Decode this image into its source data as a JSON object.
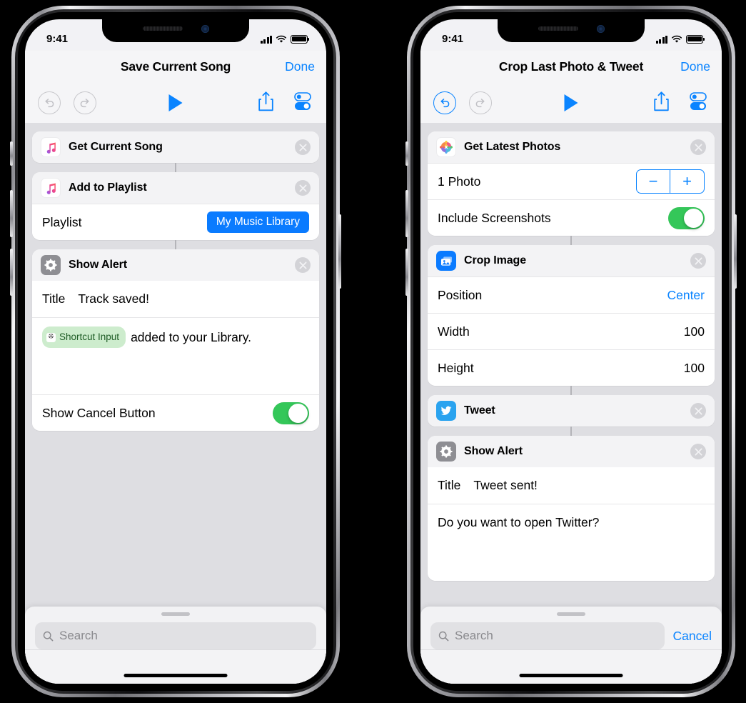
{
  "phones": [
    {
      "status": {
        "time": "9:41",
        "signal_icon": "cellular-bars-icon",
        "wifi_icon": "wifi-icon",
        "battery_icon": "battery-full-icon"
      },
      "nav": {
        "title": "Save Current Song",
        "done_label": "Done"
      },
      "toolbar": {
        "undo_icon": "undo-arrow-icon",
        "undo_enabled": "false",
        "redo_icon": "redo-arrow-icon",
        "redo_enabled": "false",
        "play_icon": "play-triangle-icon",
        "share_icon": "share-upload-icon",
        "settings_icon": "toggles-settings-icon",
        "accent": "#0a84ff"
      },
      "cards": [
        {
          "icon": "apple-music-icon",
          "title": "Get Current Song",
          "delete_icon": "close-circle-icon",
          "rows": []
        },
        {
          "icon": "apple-music-icon",
          "title": "Add to Playlist",
          "delete_icon": "close-circle-icon",
          "rows": [
            {
              "kind": "pill",
              "label": "Playlist",
              "value": "My Music Library"
            }
          ]
        },
        {
          "icon": "gear-settings-icon",
          "title": "Show Alert",
          "delete_icon": "close-circle-icon",
          "rows": [
            {
              "kind": "title",
              "label": "Title",
              "value": "Track saved!"
            },
            {
              "kind": "message",
              "token": "Shortcut Input",
              "token_icon": "variable-token-icon",
              "text": "added to your Library."
            },
            {
              "kind": "switch",
              "label": "Show Cancel Button",
              "value": "on"
            }
          ]
        }
      ],
      "sheet": {
        "search_placeholder": "Search",
        "search_icon": "search-icon",
        "cancel_label": "",
        "show_cancel": "false"
      }
    },
    {
      "status": {
        "time": "9:41",
        "signal_icon": "cellular-bars-icon",
        "wifi_icon": "wifi-icon",
        "battery_icon": "battery-full-icon"
      },
      "nav": {
        "title": "Crop Last Photo & Tweet",
        "done_label": "Done"
      },
      "toolbar": {
        "undo_icon": "undo-arrow-icon",
        "undo_enabled": "true",
        "redo_icon": "redo-arrow-icon",
        "redo_enabled": "false",
        "play_icon": "play-triangle-icon",
        "share_icon": "share-upload-icon",
        "settings_icon": "toggles-settings-icon",
        "accent": "#0a84ff"
      },
      "cards": [
        {
          "icon": "photos-app-icon",
          "title": "Get Latest Photos",
          "delete_icon": "close-circle-icon",
          "rows": [
            {
              "kind": "stepper",
              "label": "1 Photo",
              "minus": "−",
              "plus": "+"
            },
            {
              "kind": "switch",
              "label": "Include Screenshots",
              "value": "on"
            }
          ]
        },
        {
          "icon": "crop-image-icon",
          "title": "Crop Image",
          "delete_icon": "close-circle-icon",
          "rows": [
            {
              "kind": "value",
              "label": "Position",
              "value": "Center",
              "accent": "true"
            },
            {
              "kind": "value",
              "label": "Width",
              "value": "100",
              "accent": "false"
            },
            {
              "kind": "value",
              "label": "Height",
              "value": "100",
              "accent": "false"
            }
          ]
        },
        {
          "icon": "twitter-icon",
          "title": "Tweet",
          "delete_icon": "close-circle-icon",
          "rows": []
        },
        {
          "icon": "gear-settings-icon",
          "title": "Show Alert",
          "delete_icon": "close-circle-icon",
          "rows": [
            {
              "kind": "title",
              "label": "Title",
              "value": "Tweet sent!"
            },
            {
              "kind": "message",
              "token": "",
              "token_icon": "",
              "text": "Do you want to open Twitter?"
            }
          ]
        }
      ],
      "sheet": {
        "search_placeholder": "Search",
        "search_icon": "search-icon",
        "cancel_label": "Cancel",
        "show_cancel": "true"
      }
    }
  ]
}
